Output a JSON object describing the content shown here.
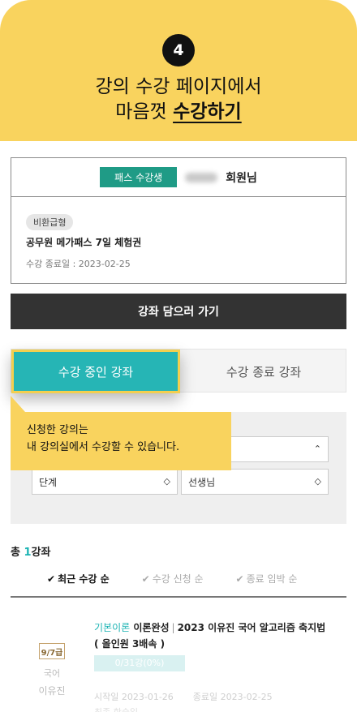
{
  "step": {
    "number": "4"
  },
  "headline": {
    "line1": "강의 수강 페이지에서",
    "line2_plain": "마음껏 ",
    "line2_bold": "수강하기"
  },
  "member": {
    "pass_badge": "패스 수강생",
    "name_suffix": "회원님",
    "refund_badge": "비환급형",
    "pass_name": "공무원 메가패스 7일 체험권",
    "end_date": "수강 종료일 : 2023-02-25"
  },
  "cta": {
    "label": "강좌 담으러 가기"
  },
  "tabs": {
    "active": "수강 중인 강좌",
    "inactive": "수강 종료 강좌"
  },
  "tooltip": {
    "line1": "신청한 강의는",
    "line2": "내 강의실에서 수강할 수 있습니다."
  },
  "filters": {
    "chevron": "⌃⌄",
    "level": "단계",
    "teacher": "선생님"
  },
  "total": {
    "prefix": "총",
    "count": "1",
    "suffix": "강좌"
  },
  "sort": {
    "options": [
      "최근 수강 순",
      "수강 신청 순",
      "종료 임박 순"
    ],
    "active_index": 0,
    "check_glyph": "✔"
  },
  "course": {
    "level_badge": "9/7급",
    "subject": "국어",
    "teacher": "이유진",
    "category": "기본이론",
    "status": "이론완성",
    "title": "2023 이유진 국어 알고리즘 축지법",
    "subtitle": "( 올인원 3배속 )",
    "progress_text": "0/31강(0%)",
    "progress_fraction": 0,
    "start_date": "시작일 2023-01-26",
    "end_date": "종료일 2023-02-25",
    "extra": "최종 학습일"
  },
  "colors": {
    "yellow": "#f9d35e",
    "teal": "#26b5b5",
    "green_badge": "#1f9b86",
    "dark_button": "#333333"
  }
}
